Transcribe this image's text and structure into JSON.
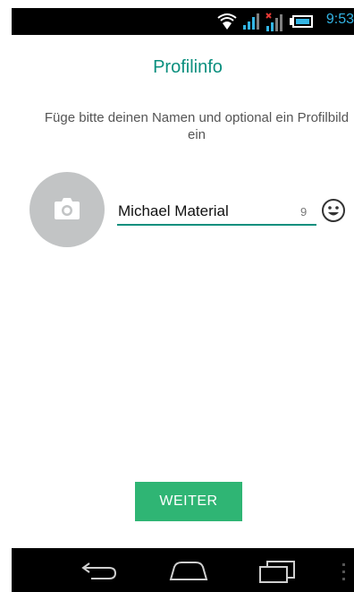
{
  "status_bar": {
    "time": "9:53",
    "icons": [
      "wifi-icon",
      "signal-icon",
      "signal-no-data-icon",
      "battery-icon"
    ]
  },
  "profile": {
    "title": "Profilinfo",
    "description": "Füge bitte deinen Namen und optional ein Profilbild ein",
    "photo_icon": "camera-icon",
    "name_value": "Michael Material",
    "char_counter": "9",
    "emoji_icon": "smiley-icon"
  },
  "actions": {
    "next_label": "WEITER"
  },
  "nav_bar": {
    "icons": [
      "back-icon",
      "home-icon",
      "recent-apps-icon",
      "menu-icon"
    ]
  },
  "colors": {
    "accent": "#0a8f7e",
    "button": "#2fb574",
    "clock": "#33b5e5"
  }
}
